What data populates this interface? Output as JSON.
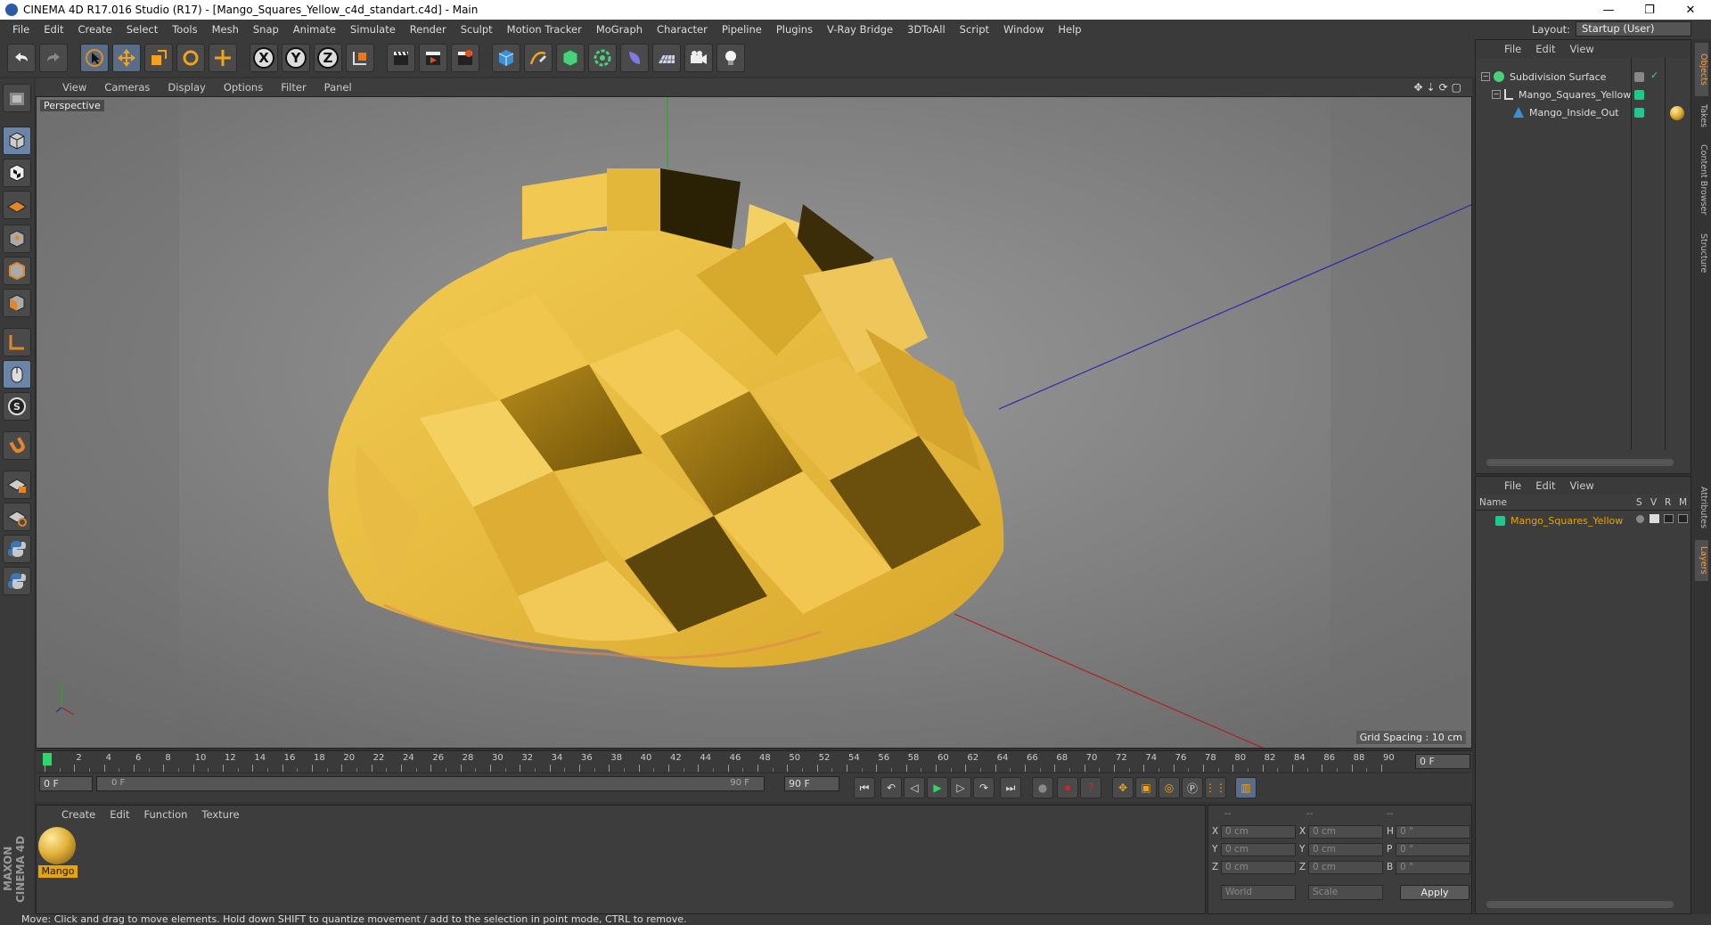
{
  "window": {
    "title": "CINEMA 4D R17.016 Studio (R17) - [Mango_Squares_Yellow_c4d_standart.c4d] - Main",
    "min": "—",
    "max": "❐",
    "close": "✕"
  },
  "menu": [
    "File",
    "Edit",
    "Create",
    "Select",
    "Tools",
    "Mesh",
    "Snap",
    "Animate",
    "Simulate",
    "Render",
    "Sculpt",
    "Motion Tracker",
    "MoGraph",
    "Character",
    "Pipeline",
    "Plugins",
    "V-Ray Bridge",
    "3DToAll",
    "Script",
    "Window",
    "Help"
  ],
  "layout": {
    "label": "Layout:",
    "value": "Startup (User)"
  },
  "viewport": {
    "menu": [
      "View",
      "Cameras",
      "Display",
      "Options",
      "Filter",
      "Panel"
    ],
    "label": "Perspective",
    "grid_spacing": "Grid Spacing : 10 cm"
  },
  "timeline": {
    "ticks": [
      "0",
      "2",
      "4",
      "6",
      "8",
      "10",
      "12",
      "14",
      "16",
      "18",
      "20",
      "22",
      "24",
      "26",
      "28",
      "30",
      "32",
      "34",
      "36",
      "38",
      "40",
      "42",
      "44",
      "46",
      "48",
      "50",
      "52",
      "54",
      "56",
      "58",
      "60",
      "62",
      "64",
      "66",
      "68",
      "70",
      "72",
      "74",
      "76",
      "78",
      "80",
      "82",
      "84",
      "86",
      "88",
      "90"
    ],
    "current": "0 F",
    "start": "0 F",
    "range_start": "0 F",
    "range_end": "90 F",
    "end": "90 F"
  },
  "material": {
    "menu": [
      "Create",
      "Edit",
      "Function",
      "Texture"
    ],
    "items": [
      {
        "name": "Mango"
      }
    ]
  },
  "coords": {
    "header": [
      "--",
      "--",
      "--"
    ],
    "rows": [
      {
        "a": "X",
        "av": "0 cm",
        "b": "X",
        "bv": "0 cm",
        "c": "H",
        "cv": "0 °"
      },
      {
        "a": "Y",
        "av": "0 cm",
        "b": "Y",
        "bv": "0 cm",
        "c": "P",
        "cv": "0 °"
      },
      {
        "a": "Z",
        "av": "0 cm",
        "b": "Z",
        "bv": "0 cm",
        "c": "B",
        "cv": "0 °"
      }
    ],
    "mode1": "World",
    "mode2": "Scale",
    "apply": "Apply"
  },
  "objects": {
    "menu": [
      "File",
      "Edit",
      "View"
    ],
    "items": [
      {
        "name": "Subdivision Surface"
      },
      {
        "name": "Mango_Squares_Yellow"
      },
      {
        "name": "Mango_Inside_Out"
      }
    ]
  },
  "layers": {
    "menu": [
      "File",
      "Edit",
      "View"
    ],
    "header": {
      "name": "Name",
      "s": "S",
      "v": "V",
      "r": "R",
      "m": "M"
    },
    "items": [
      {
        "name": "Mango_Squares_Yellow"
      }
    ]
  },
  "sidetabs": [
    "Objects",
    "Takes",
    "Content Browser",
    "Structure",
    "Attributes",
    "Layers"
  ],
  "brand": "MAXON CINEMA 4D",
  "status": "Move: Click and drag to move elements. Hold down SHIFT to quantize movement / add to the selection in point mode, CTRL to remove.",
  "colors": {
    "accent": "#e8a400",
    "layer": "#1fc98a",
    "mango": "#e2b33b"
  }
}
